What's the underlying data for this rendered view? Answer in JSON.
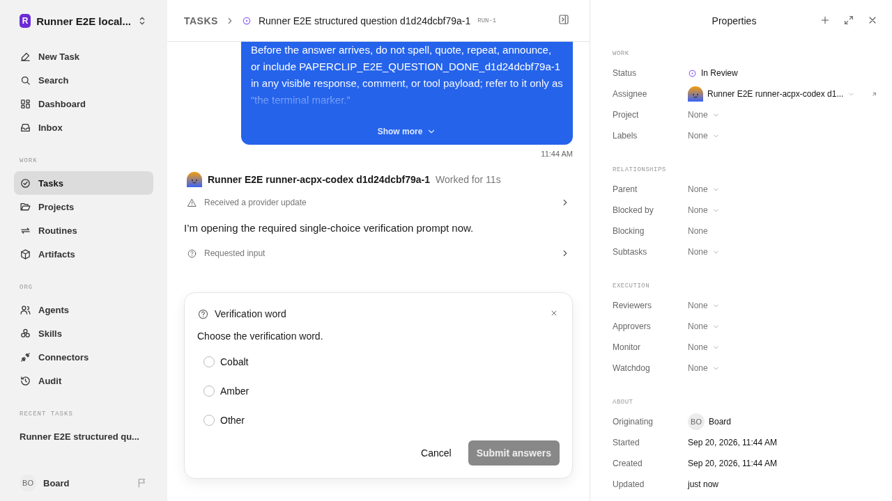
{
  "sidebar": {
    "workspace": {
      "initial": "R",
      "name": "Runner E2E local..."
    },
    "top_items": [
      {
        "label": "New Task",
        "selected": false
      },
      {
        "label": "Search",
        "selected": false
      },
      {
        "label": "Dashboard",
        "selected": false
      },
      {
        "label": "Inbox",
        "selected": false
      }
    ],
    "sections": [
      {
        "title": "WORK",
        "items": [
          {
            "label": "Tasks",
            "selected": true
          },
          {
            "label": "Projects",
            "selected": false
          },
          {
            "label": "Routines",
            "selected": false
          },
          {
            "label": "Artifacts",
            "selected": false
          }
        ]
      },
      {
        "title": "ORG",
        "items": [
          {
            "label": "Agents",
            "selected": false
          },
          {
            "label": "Skills",
            "selected": false
          },
          {
            "label": "Connectors",
            "selected": false
          },
          {
            "label": "Audit",
            "selected": false
          }
        ]
      },
      {
        "title": "RECENT TASKS",
        "items": [
          {
            "label": "Runner E2E structured qu...",
            "selected": false
          }
        ]
      }
    ],
    "user": {
      "initials": "BO",
      "name": "Board"
    }
  },
  "breadcrumb": {
    "root": "TASKS",
    "title": "Runner E2E structured question d1d24dcbf79a-1",
    "tag": "RUN-1"
  },
  "message": {
    "text": "Before the answer arrives, do not spell, quote, repeat, announce, or include PAPERCLIP_E2E_QUESTION_DONE_d1d24dcbf79a-1 in any visible response, comment, or tool payload; refer to it only as “the terminal marker.”",
    "show_more": "Show more",
    "time": "11:44 AM"
  },
  "agent_run": {
    "name": "Runner E2E runner-acpx-codex d1d24dcbf79a-1",
    "duration": "Worked for 11s",
    "events": [
      {
        "kind": "update",
        "text": "Received a provider update"
      },
      {
        "kind": "text",
        "text": "I’m opening the required single-choice verification prompt now."
      },
      {
        "kind": "input",
        "text": "Requested input"
      }
    ]
  },
  "question": {
    "title": "Verification word",
    "prompt": "Choose the verification word.",
    "options": [
      {
        "label": "Cobalt",
        "selected": false
      },
      {
        "label": "Amber",
        "selected": false
      },
      {
        "label": "Other",
        "selected": false
      }
    ],
    "cancel": "Cancel",
    "submit": {
      "label": "Submit answers",
      "disabled": true
    }
  },
  "properties": {
    "title": "Properties",
    "sections": [
      {
        "title": "WORK",
        "rows": [
          {
            "label": "Status",
            "kind": "status",
            "value": "In Review"
          },
          {
            "label": "Assignee",
            "kind": "agent",
            "value": "Runner E2E runner-acpx-codex d1..."
          },
          {
            "label": "Project",
            "kind": "none",
            "value": "None",
            "menu": true
          },
          {
            "label": "Labels",
            "kind": "none",
            "value": "None",
            "menu": true
          }
        ]
      },
      {
        "title": "RELATIONSHIPS",
        "rows": [
          {
            "label": "Parent",
            "kind": "none",
            "value": "None",
            "menu": true
          },
          {
            "label": "Blocked by",
            "kind": "none",
            "value": "None",
            "menu": true
          },
          {
            "label": "Blocking",
            "kind": "none",
            "value": "None",
            "menu": false
          },
          {
            "label": "Subtasks",
            "kind": "none",
            "value": "None",
            "menu": true
          }
        ]
      },
      {
        "title": "EXECUTION",
        "rows": [
          {
            "label": "Reviewers",
            "kind": "none",
            "value": "None",
            "menu": true
          },
          {
            "label": "Approvers",
            "kind": "none",
            "value": "None",
            "menu": true
          },
          {
            "label": "Monitor",
            "kind": "none",
            "value": "None",
            "menu": true
          },
          {
            "label": "Watchdog",
            "kind": "none",
            "value": "None",
            "menu": true
          }
        ]
      },
      {
        "title": "ABOUT",
        "rows": [
          {
            "label": "Originating",
            "kind": "user",
            "initials": "BO",
            "value": "Board"
          },
          {
            "label": "Started",
            "kind": "text",
            "value": "Sep 20, 2026, 11:44 AM"
          },
          {
            "label": "Created",
            "kind": "text",
            "value": "Sep 20, 2026, 11:44 AM"
          },
          {
            "label": "Updated",
            "kind": "text",
            "value": "just now"
          }
        ]
      }
    ]
  }
}
